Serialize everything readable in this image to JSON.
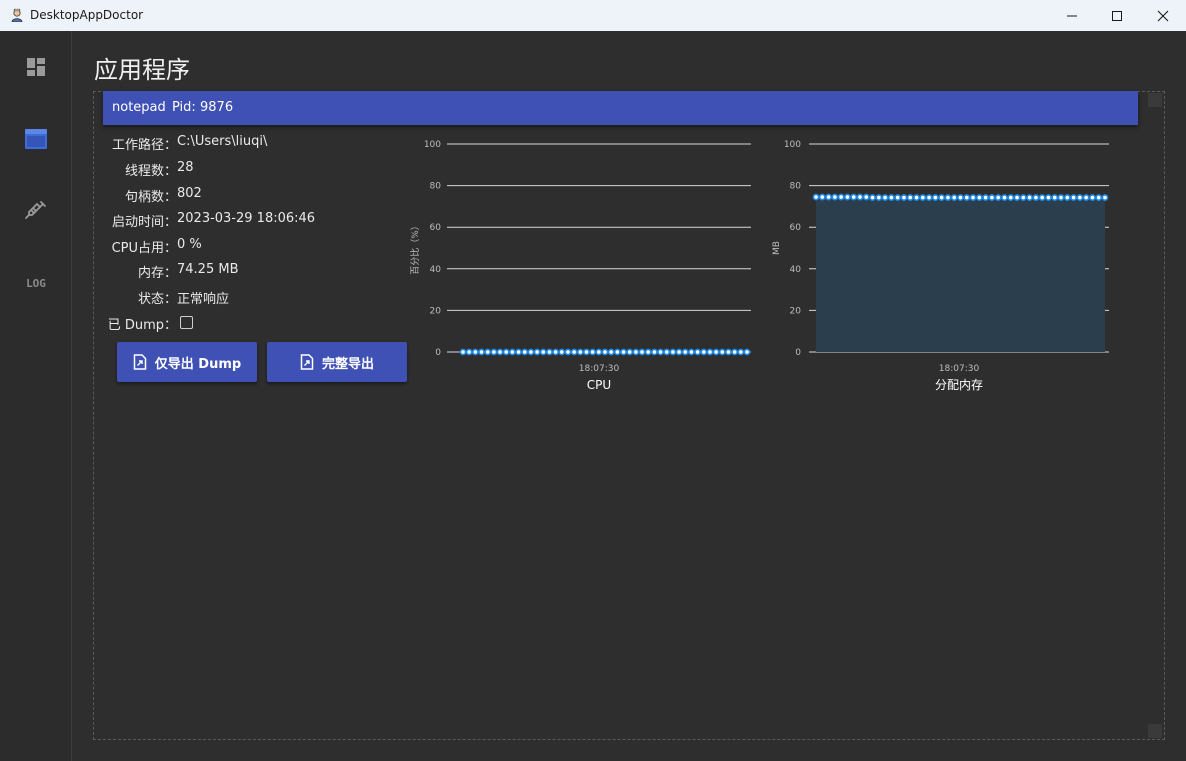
{
  "window": {
    "title": "DesktopAppDoctor",
    "controls": {
      "minimize": "minimize-icon",
      "maximize": "maximize-icon",
      "close": "close-icon"
    }
  },
  "sidebar": {
    "items": [
      {
        "name": "dashboard",
        "icon": "dashboard-icon",
        "active": false
      },
      {
        "name": "applications",
        "icon": "window-icon",
        "active": true
      },
      {
        "name": "inject",
        "icon": "syringe-icon",
        "active": false
      },
      {
        "name": "log",
        "label": "LOG",
        "active": false
      }
    ]
  },
  "page": {
    "title": "应用程序"
  },
  "process": {
    "name": "notepad",
    "pid_label": "Pid:",
    "pid": "9876",
    "info": [
      {
        "label": "工作路径：",
        "value": "C:\\Users\\liuqi\\"
      },
      {
        "label": "线程数：",
        "value": "28"
      },
      {
        "label": "句柄数：",
        "value": "802"
      },
      {
        "label": "启动时间：",
        "value": "2023-03-29 18:06:46"
      },
      {
        "label": "CPU占用：",
        "value": "0 %"
      },
      {
        "label": "内存：",
        "value": "74.25 MB"
      },
      {
        "label": "状态：",
        "value": "正常响应"
      },
      {
        "label": "已 Dump：",
        "value": ""
      }
    ],
    "dumped": false,
    "buttons": {
      "dump_only": "仅导出 Dump",
      "full_export": "完整导出"
    }
  },
  "colors": {
    "accent": "#3f51b5",
    "series_line": "#1e88e5",
    "series_fill": "#2b3e4e"
  },
  "chart_data": [
    {
      "type": "line",
      "title": "CPU",
      "ylabel": "百分比（%）",
      "ylim": [
        0,
        100
      ],
      "yticks": [
        0,
        20,
        40,
        60,
        80,
        100
      ],
      "x_tick_label": "18:07:30",
      "grid": true,
      "series": [
        {
          "values": [
            0,
            0,
            0,
            0,
            0,
            0,
            0,
            0,
            0,
            0,
            0,
            0,
            0,
            0,
            0,
            0,
            0,
            0,
            0,
            0,
            0,
            0,
            0,
            0,
            0,
            0,
            0,
            0,
            0,
            0,
            0,
            0,
            0,
            0,
            0,
            0,
            0,
            0,
            0,
            0,
            0,
            0,
            0,
            0,
            0,
            0,
            0
          ]
        }
      ]
    },
    {
      "type": "area",
      "title": "分配内存",
      "ylabel": "MB",
      "ylim": [
        0,
        100
      ],
      "yticks": [
        0,
        20,
        40,
        60,
        80,
        100
      ],
      "x_tick_label": "18:07:30",
      "grid": true,
      "series": [
        {
          "values": [
            74.5,
            74.5,
            74.5,
            74.5,
            74.5,
            74.5,
            74.5,
            74.5,
            74.5,
            74.25,
            74.25,
            74.25,
            74.25,
            74.25,
            74.25,
            74.25,
            74.25,
            74.25,
            74.25,
            74.25,
            74.25,
            74.25,
            74.25,
            74.25,
            74.25,
            74.25,
            74.25,
            74.25,
            74.25,
            74.25,
            74.25,
            74.25,
            74.25,
            74.25,
            74.25,
            74.25,
            74.25,
            74.25,
            74.25,
            74.25,
            74.25,
            74.25,
            74.25,
            74.25,
            74.25,
            74.25,
            74.25
          ]
        }
      ]
    }
  ]
}
